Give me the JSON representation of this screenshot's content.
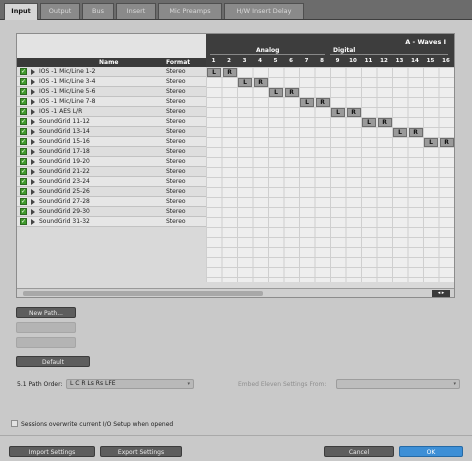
{
  "tabs": [
    {
      "label": "Input",
      "active": true
    },
    {
      "label": "Output",
      "active": false
    },
    {
      "label": "Bus",
      "active": false
    },
    {
      "label": "Insert",
      "active": false
    },
    {
      "label": "Mic Preamps",
      "active": false
    },
    {
      "label": "H/W Insert Delay",
      "active": false
    }
  ],
  "table": {
    "name_header": "Name",
    "format_header": "Format",
    "device_title": "A - Waves I",
    "group_analog": "Analog",
    "group_digital": "Digital",
    "channel_numbers": [
      "1",
      "2",
      "3",
      "4",
      "5",
      "6",
      "7",
      "8",
      "9",
      "10",
      "11",
      "12",
      "13",
      "14",
      "15",
      "16"
    ],
    "rows": [
      {
        "name": "IOS -1 Mic/Line 1-2",
        "format": "Stereo",
        "checked": true,
        "channels": [
          1,
          2
        ]
      },
      {
        "name": "IOS -1 Mic/Line 3-4",
        "format": "Stereo",
        "checked": true,
        "channels": [
          3,
          4
        ]
      },
      {
        "name": "IOS -1 Mic/Line 5-6",
        "format": "Stereo",
        "checked": true,
        "channels": [
          5,
          6
        ]
      },
      {
        "name": "IOS -1 Mic/Line 7-8",
        "format": "Stereo",
        "checked": true,
        "channels": [
          7,
          8
        ]
      },
      {
        "name": "IOS -1 AES L/R",
        "format": "Stereo",
        "checked": true,
        "channels": [
          9,
          10
        ]
      },
      {
        "name": "SoundGrid 11-12",
        "format": "Stereo",
        "checked": true,
        "channels": [
          11,
          12
        ]
      },
      {
        "name": "SoundGrid 13-14",
        "format": "Stereo",
        "checked": true,
        "channels": [
          13,
          14
        ]
      },
      {
        "name": "SoundGrid 15-16",
        "format": "Stereo",
        "checked": true,
        "channels": [
          15,
          16
        ]
      },
      {
        "name": "SoundGrid 17-18",
        "format": "Stereo",
        "checked": true,
        "channels": []
      },
      {
        "name": "SoundGrid 19-20",
        "format": "Stereo",
        "checked": true,
        "channels": []
      },
      {
        "name": "SoundGrid 21-22",
        "format": "Stereo",
        "checked": true,
        "channels": []
      },
      {
        "name": "SoundGrid 23-24",
        "format": "Stereo",
        "checked": true,
        "channels": []
      },
      {
        "name": "SoundGrid 25-26",
        "format": "Stereo",
        "checked": true,
        "channels": []
      },
      {
        "name": "SoundGrid 27-28",
        "format": "Stereo",
        "checked": true,
        "channels": []
      },
      {
        "name": "SoundGrid 29-30",
        "format": "Stereo",
        "checked": true,
        "channels": []
      },
      {
        "name": "SoundGrid 31-32",
        "format": "Stereo",
        "checked": true,
        "channels": []
      }
    ],
    "cell_left": "L",
    "cell_right": "R"
  },
  "buttons": {
    "new_path": "New Path...",
    "default": "Default",
    "import": "Import Settings",
    "export": "Export Settings",
    "cancel": "Cancel",
    "ok": "OK"
  },
  "path_order": {
    "label": "5.1 Path Order:",
    "value": "L C R Ls Rs LFE"
  },
  "embed": {
    "label": "Embed Eleven Settings From:",
    "value": ""
  },
  "sessions_option": {
    "label": "Sessions overwrite current I/O Setup when opened",
    "checked": false
  },
  "colors": {
    "accent": "#3d8fd6",
    "check_green": "#3f9a2c",
    "header_dark": "#3d3d3d"
  }
}
